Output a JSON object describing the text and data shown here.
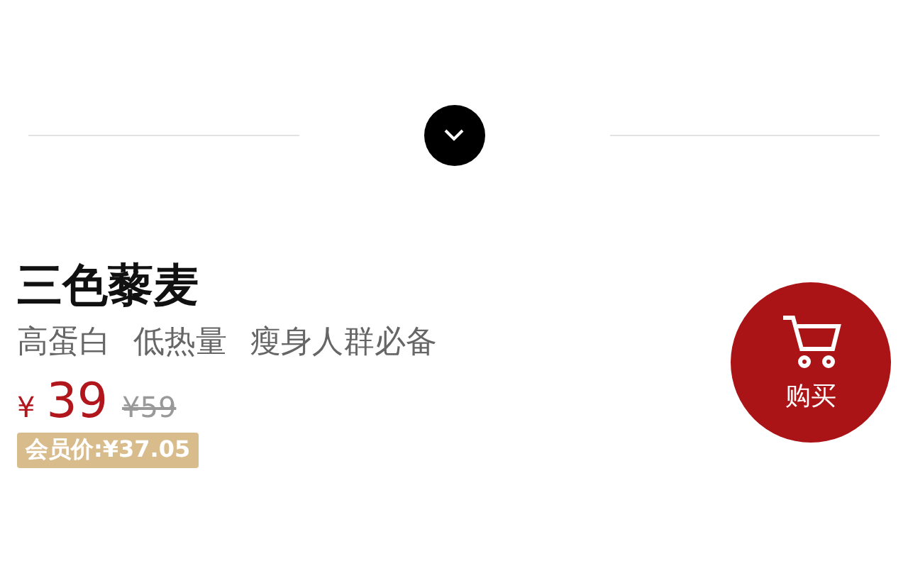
{
  "product": {
    "title": "三色藜麦",
    "tags": [
      "高蛋白",
      "低热量",
      "瘦身人群必备"
    ],
    "currency": "¥",
    "price": "39",
    "original_price": "¥59",
    "member_price": "会员价:¥37.05"
  },
  "buy_button": {
    "label": "购买"
  }
}
